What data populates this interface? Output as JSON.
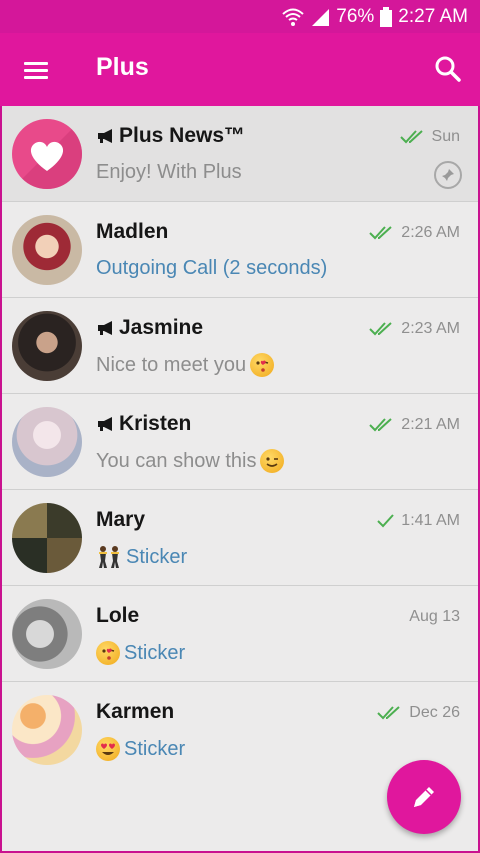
{
  "status_bar": {
    "battery": "76%",
    "time": "2:27 AM"
  },
  "app_bar": {
    "title": "Plus"
  },
  "colors": {
    "accent": "#e0179d",
    "check": "#4caf50",
    "link": "#4a87b4"
  },
  "chats": [
    {
      "name": "Plus News™",
      "channel": true,
      "message": "Enjoy! With Plus",
      "message_style": "gray",
      "time": "Sun",
      "ticks": "double",
      "pinned": true,
      "avatar": "heart-logo"
    },
    {
      "name": "Madlen",
      "channel": false,
      "message": "Outgoing Call (2 seconds)",
      "message_style": "blue",
      "time": "2:26 AM",
      "ticks": "double",
      "avatar": "photo-red-hair"
    },
    {
      "name": "Jasmine",
      "channel": true,
      "message": "Nice to meet you",
      "emoji": "kiss-emoji",
      "message_style": "gray",
      "time": "2:23 AM",
      "ticks": "double",
      "avatar": "photo-dark"
    },
    {
      "name": "Kristen",
      "channel": true,
      "message": "You can show this",
      "emoji": "wink-emoji",
      "message_style": "gray",
      "time": "2:21 AM",
      "ticks": "double",
      "avatar": "photo-light"
    },
    {
      "name": "Mary",
      "channel": false,
      "message": "Sticker",
      "emoji": "dancers-emoji",
      "message_style": "blue",
      "time": "1:41 AM",
      "ticks": "single",
      "avatar": "photo-collage"
    },
    {
      "name": "Lole",
      "channel": false,
      "message": "Sticker",
      "emoji": "kiss-emoji",
      "message_style": "blue",
      "time": "Aug 13",
      "ticks": "none",
      "avatar": "photo-grayscale"
    },
    {
      "name": "Karmen",
      "channel": false,
      "message": "Sticker",
      "emoji": "heart-eyes-emoji",
      "message_style": "blue",
      "time": "Dec 26",
      "ticks": "double",
      "avatar": "photo-flowers"
    }
  ]
}
